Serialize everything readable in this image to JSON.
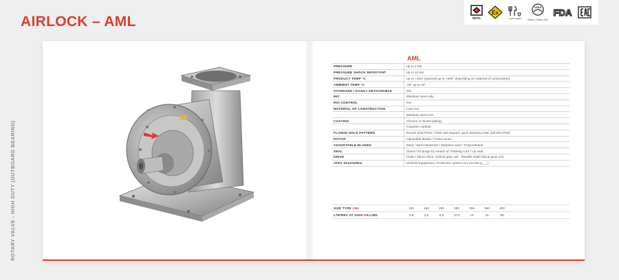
{
  "header": {
    "title": "AIRLOCK – AML",
    "side_caption": "ROTARY VALVE - HIGH DUTY (OUTBOARD BEARING)"
  },
  "certifications": [
    {
      "name": "NFPA",
      "icon": "nfpa-icon"
    },
    {
      "name": "Ex",
      "icon": "atex-ex-icon"
    },
    {
      "name": "Food contact",
      "icon": "food-contact-icon"
    },
    {
      "name": "USDA Dairy / Dairy Mill",
      "icon": "usda-dairy-icon",
      "caption": "Dairy / Dairy Mill"
    },
    {
      "name": "FDA",
      "icon": "fda-icon"
    },
    {
      "name": "EAC",
      "icon": "eac-icon"
    }
  ],
  "spec": {
    "title": "AML",
    "rows": [
      {
        "label": "PRESSURE",
        "value": "Up to 2 bar"
      },
      {
        "label": "PRESSURE SHOCK RESISTANT",
        "value": "Up to 10 bar"
      },
      {
        "label": "PRODUCT TEMP °C",
        "value": "Up to +150° (optional up to +600° depending on material of construction)"
      },
      {
        "label": "AMBIENT TEMP °C",
        "value": "-20° up to 40°"
      },
      {
        "label": "STANDARD / EASILY DETACHABLE",
        "value": "Yes"
      },
      {
        "label": "MIC",
        "value": "Stainless steel only"
      },
      {
        "label": "RIO CONTROL",
        "value": "Yes"
      },
      {
        "label": "MATERIAL OF CONSTRUCTION",
        "value": "Cast iron"
      },
      {
        "label": "",
        "value": "Stainless steel 316"
      },
      {
        "label": "COATING",
        "value": "Chrome or Nickel plating"
      },
      {
        "label": "",
        "value": "Tungsten carbide"
      },
      {
        "label": "FLANGE HOLE PATTERN",
        "value": "Round: DIN PN10 / ANSI 150     Square: upon drawing (AML 100 DIN PN6)"
      },
      {
        "label": "ROTOR",
        "value": "Adjustable blades / Fixed vanes"
      },
      {
        "label": "ADJUSTABLE BLADES",
        "value": "Steel / Steel hardened / Stainless steel / Polyurethane"
      },
      {
        "label": "SEAL",
        "value": "Gland / Air purge by means of: Packing cord / Lip seal"
      },
      {
        "label": "DRIVE",
        "value": "Chain / Direct drive: Helical gear unit - Parallel shaft helical gear unit"
      },
      {
        "label": "ATEX 2014/34/EU",
        "value": "1D/2GD Equipment / Protective system st.2 (10 bar p___)"
      }
    ]
  },
  "sizes": {
    "size_label_prefix": "SIZE TYPE",
    "size_label_accent": "AML",
    "fill_label": "LTR/REV AT 100% FILLING",
    "sizes": [
      "100",
      "150",
      "200",
      "250",
      "300",
      "350",
      "400"
    ],
    "litres": [
      "0.8",
      "2.5",
      "5.5",
      "10.5",
      "19",
      "34",
      "58"
    ]
  },
  "colors": {
    "accent": "#d8402e",
    "page_bg": "#efefef"
  }
}
